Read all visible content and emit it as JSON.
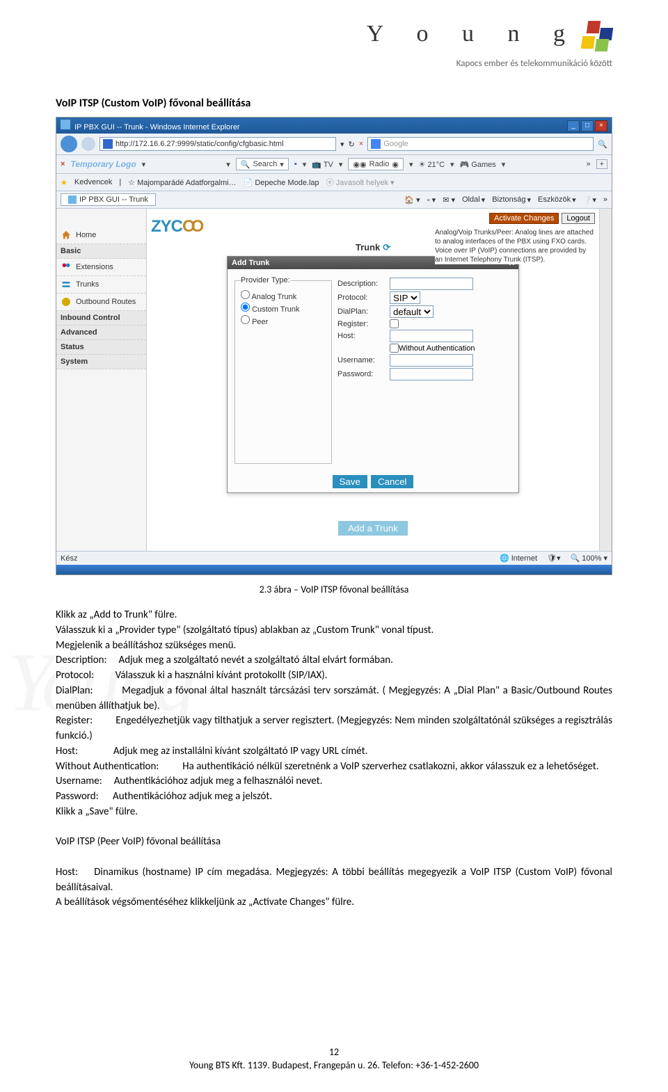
{
  "brand": {
    "name": "Y o u n g",
    "tagline": "Kapocs ember és telekommunikáció között"
  },
  "section_title": "VoIP ITSP (Custom VoIP) fővonal beállítása",
  "caption": "2.3 ábra – VoIP ITSP fővonal beállítása",
  "browser": {
    "window_title": "IP PBX GUI -- Trunk - Windows Internet Explorer",
    "url": "http://172.16.6.27:9999/static/config/cfgbasic.html",
    "search_placeholder": "Google",
    "toolbar": {
      "logo": "Temporary Logo",
      "search": "Search",
      "tv": "TV",
      "radio": "Radio",
      "weather": "21°C",
      "games": "Games"
    },
    "favorites": {
      "label": "Kedvencek",
      "items": [
        "Majomparádé Adatforgalmi…",
        "Depeche Mode.lap",
        "Javasolt helyek"
      ]
    },
    "tab": "IP PBX GUI -- Trunk",
    "menu": [
      "Oldal",
      "Biztonság",
      "Eszközök"
    ],
    "status_left": "Kész",
    "status_internet": "Internet",
    "status_zoom": "100%"
  },
  "app": {
    "logo": "ZYCOO",
    "sidebar": {
      "items": [
        {
          "icon": "home",
          "label": "Home"
        },
        {
          "cat": true,
          "label": "Basic"
        },
        {
          "icon": "ext",
          "label": "Extensions"
        },
        {
          "icon": "trunk",
          "label": "Trunks"
        },
        {
          "icon": "route",
          "label": "Outbound Routes"
        },
        {
          "cat": true,
          "label": "Inbound Control"
        },
        {
          "cat": true,
          "label": "Advanced"
        },
        {
          "cat": true,
          "label": "Status"
        },
        {
          "cat": true,
          "label": "System"
        }
      ]
    },
    "title": "Trunk",
    "buttons": {
      "activate": "Activate Changes",
      "logout": "Logout"
    },
    "info": "Analog/Voip Trunks/Peer: Analog lines are attached to analog interfaces of the PBX using FXO cards. Voice over IP (VoIP) connections are provided by an Internet Telephony Trunk (ITSP).",
    "modal": {
      "title": "Add Trunk",
      "close": "X",
      "provider_legend": "Provider Type:",
      "providers": [
        "Analog Trunk",
        "Custom Trunk",
        "Peer"
      ],
      "provider_selected": "Custom Trunk",
      "fields": {
        "description": "Description:",
        "protocol": "Protocol:",
        "protocol_value": "SIP",
        "dialplan": "DialPlan:",
        "dialplan_value": "default",
        "register": "Register:",
        "host": "Host:",
        "without_auth": "Without Authentication",
        "username": "Username:",
        "password": "Password:"
      },
      "save": "Save",
      "cancel": "Cancel"
    },
    "add_trunk": "Add a Trunk"
  },
  "doc": {
    "p1": "Klikk az „Add to Trunk\" fülre.",
    "p2": "Válasszuk ki a „Provider type\" (szolgáltató típus) ablakban az „Custom Trunk\" vonal típust.",
    "p3": "Megjelenik a beállításhoz szükséges menü.",
    "desc_lbl": "Description:",
    "desc_txt": "Adjuk meg a szolgáltató nevét a szolgáltató által elvárt formában.",
    "proto_lbl": "Protocol:",
    "proto_txt": "Válasszuk ki a használni kívánt protokollt (SIP/IAX).",
    "dial_lbl": "DialPlan:",
    "dial_txt": "Megadjuk a fővonal által használt tárcsázási terv sorszámát. ( Megjegyzés: A „Dial Plan\" a Basic/Outbound Routes menüben állíthatjuk be).",
    "reg_lbl": "Register:",
    "reg_txt": "Engedélyezhetjük vagy tilthatjuk a server regisztert. (Megjegyzés: Nem minden szolgáltatónál szükséges a regisztrálás funkció.)",
    "host_lbl": "Host:",
    "host_txt": "Adjuk meg az installálni kívánt szolgáltató IP vagy URL címét.",
    "wa_lbl": "Without Authentication:",
    "wa_txt": "Ha authentikáció nélkül szeretnénk a VoIP szerverhez csatlakozni, akkor válasszuk ez a lehetőséget.",
    "user_lbl": "Username:",
    "user_txt": "Authentikációhoz adjuk meg a felhasználói nevet.",
    "pass_lbl": "Password:",
    "pass_txt": "Authentikációhoz adjuk meg a jelszót.",
    "p_save": "Klikk a „Save\" fülre.",
    "peer_title": "VoIP ITSP (Peer VoIP) fővonal beállítása",
    "peer_host_lbl": "Host:",
    "peer_host_txt": "Dinamikus (hostname) IP cím megadása. Megjegyzés: A többi beállítás megegyezik a VoIP ITSP (Custom VoIP) fővonal beállításaival.",
    "peer_final": "A beállítások végsőmentéséhez klikkeljünk az „Activate Changes\" fülre."
  },
  "footer": {
    "page": "12",
    "addr": "Young BTS Kft. 1139. Budapest, Frangepán u. 26. Telefon: +36-1-452-2600"
  },
  "watermark": "Young"
}
